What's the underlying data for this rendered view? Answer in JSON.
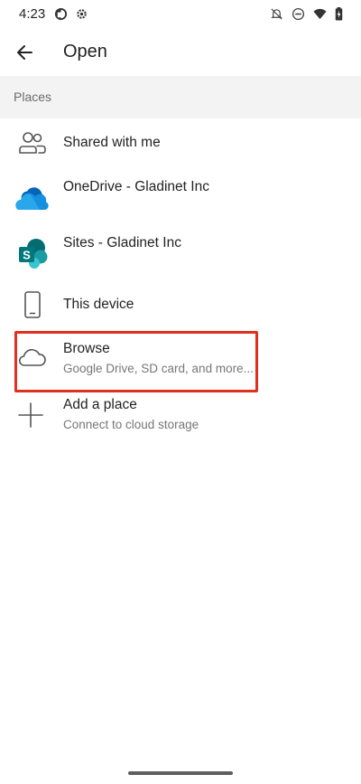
{
  "status_bar": {
    "time": "4:23",
    "left_icons": [
      "data-saver-icon",
      "settings-gear-icon"
    ],
    "right_icons": [
      "notifications-off-icon",
      "do-not-disturb-icon",
      "wifi-icon",
      "battery-charging-icon"
    ]
  },
  "app_bar": {
    "title": "Open",
    "back_icon": "arrow-back-icon"
  },
  "places": {
    "header": "Places",
    "items": [
      {
        "title": "Shared with me",
        "subtitle": "",
        "icon": "people-icon"
      },
      {
        "title": "OneDrive - Gladinet Inc",
        "subtitle": "",
        "icon": "onedrive-cloud-icon"
      },
      {
        "title": "Sites - Gladinet Inc",
        "subtitle": "",
        "icon": "sharepoint-icon"
      },
      {
        "title": "This device",
        "subtitle": "",
        "icon": "phone-icon"
      },
      {
        "title": "Browse",
        "subtitle": "Google Drive, SD card, and more...",
        "icon": "cloud-outline-icon"
      },
      {
        "title": "Add a place",
        "subtitle": "Connect to cloud storage",
        "icon": "plus-icon"
      }
    ]
  },
  "colors": {
    "highlight": "#e0301e",
    "onedrive_blue": "#0f78d4",
    "sharepoint_teal": "#037a7a",
    "section_bg": "#f3f3f3"
  }
}
